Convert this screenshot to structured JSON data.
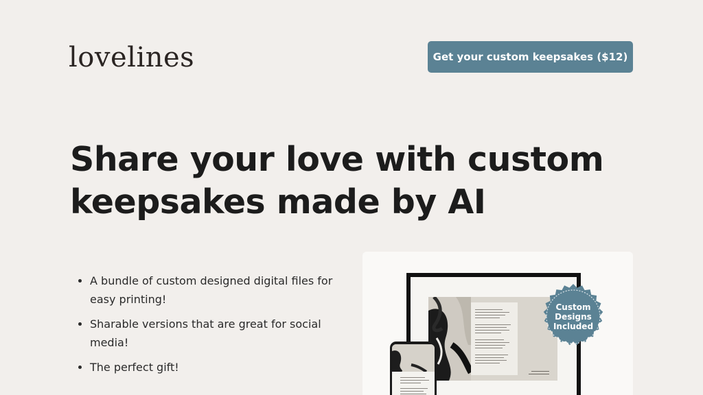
{
  "brand": {
    "logo_text": "lovelines"
  },
  "header": {
    "cta_label": "Get your custom keepsakes ($12)"
  },
  "hero": {
    "headline_line1": "Share your love with custom",
    "headline_line2": "keepsakes made by AI"
  },
  "features": [
    "A bundle of custom designed digital files for easy printing!",
    "Sharable versions that are great for social media!",
    "The perfect gift!"
  ],
  "badge": {
    "line1": "Custom",
    "line2": "Designs",
    "line3": "Included"
  },
  "colors": {
    "accent": "#5b8294",
    "background": "#f2efec",
    "text": "#1c1c1c"
  }
}
